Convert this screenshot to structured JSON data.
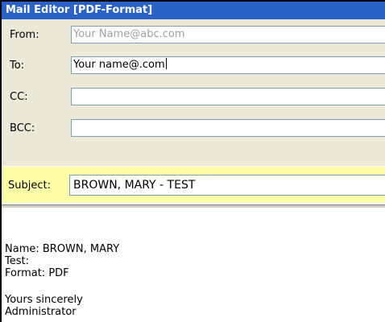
{
  "window": {
    "title": "Mail Editor [PDF-Format]"
  },
  "form": {
    "from": {
      "label": "From:",
      "value": "Your Name@abc.com"
    },
    "to": {
      "label": "To:",
      "value": "Your name@.com"
    },
    "cc": {
      "label": "CC:",
      "value": ""
    },
    "bcc": {
      "label": "BCC:",
      "value": ""
    },
    "subject": {
      "label": "Subject:",
      "value": "BROWN, MARY - TEST"
    }
  },
  "body": {
    "lines": [
      "Name:  BROWN, MARY",
      "Test:",
      "Format:  PDF",
      "Yours sincerely",
      "Administrator"
    ]
  },
  "colors": {
    "titlebar": "#2a62c8",
    "form_background": "#ece9d8",
    "subject_highlight": "#ffffa8"
  }
}
